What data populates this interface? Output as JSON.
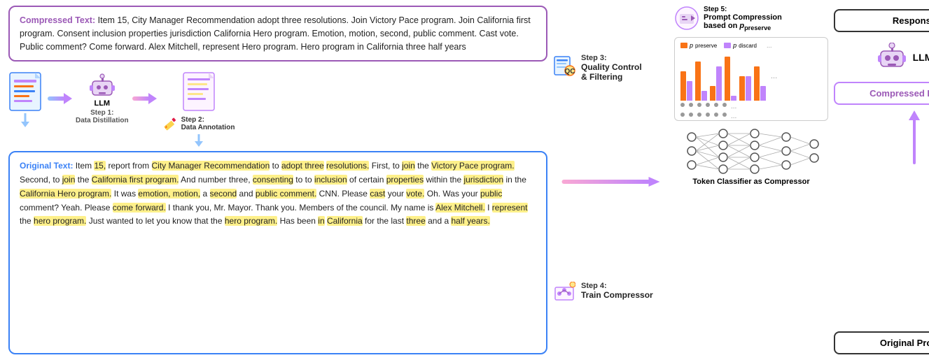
{
  "compressed_text": {
    "label": "Compressed Text:",
    "content": "Item 15, City Manager Recommendation adopt three resolutions. Join Victory Pace program. Join California first program. Consent inclusion properties jurisdiction California Hero program. Emotion, motion, second, public comment. Cast vote. Public comment? Come forward. Alex Mitchell, represent Hero program. Hero program in California three half years"
  },
  "original_text": {
    "label": "Original Text:",
    "sentences": [
      {
        "text": "Item ",
        "highlight": false
      },
      {
        "text": "15,",
        "highlight": true
      },
      {
        "text": " report from ",
        "highlight": false
      },
      {
        "text": "City Manager Recommendation",
        "highlight": true
      },
      {
        "text": " to ",
        "highlight": false
      },
      {
        "text": "adopt three",
        "highlight": true
      },
      {
        "text": "\n",
        "highlight": false
      },
      {
        "text": "resolutions.",
        "highlight": true
      },
      {
        "text": " First, to ",
        "highlight": false
      },
      {
        "text": "join",
        "highlight": true
      },
      {
        "text": " the ",
        "highlight": false
      },
      {
        "text": "Victory Pace program.",
        "highlight": true
      },
      {
        "text": " Second, to ",
        "highlight": false
      },
      {
        "text": "join",
        "highlight": true
      },
      {
        "text": " the\n",
        "highlight": false
      },
      {
        "text": "California first program.",
        "highlight": true
      },
      {
        "text": " And number three, ",
        "highlight": false
      },
      {
        "text": "consenting",
        "highlight": true
      },
      {
        "text": " to to ",
        "highlight": false
      },
      {
        "text": "inclusion",
        "highlight": true
      },
      {
        "text": " of\ncertain ",
        "highlight": false
      },
      {
        "text": "properties",
        "highlight": true
      },
      {
        "text": " within the ",
        "highlight": false
      },
      {
        "text": "jurisdiction",
        "highlight": true
      },
      {
        "text": " in the ",
        "highlight": false
      },
      {
        "text": "California Hero program.",
        "highlight": true
      },
      {
        "text": " It\nwas ",
        "highlight": false
      },
      {
        "text": "emotion, motion,",
        "highlight": true
      },
      {
        "text": " a ",
        "highlight": false
      },
      {
        "text": "second",
        "highlight": true
      },
      {
        "text": " and ",
        "highlight": false
      },
      {
        "text": "public comment.",
        "highlight": true
      },
      {
        "text": " CNN. Please ",
        "highlight": false
      },
      {
        "text": "cast",
        "highlight": true
      },
      {
        "text": " your ",
        "highlight": false
      },
      {
        "text": "vote.",
        "highlight": true
      },
      {
        "text": "\nOh. Was your ",
        "highlight": false
      },
      {
        "text": "public",
        "highlight": true
      },
      {
        "text": " comment? Yeah. Please ",
        "highlight": false
      },
      {
        "text": "come forward.",
        "highlight": true
      },
      {
        "text": " I thank you, Mr. Mayor.\nThank you. Members of the council. My name is ",
        "highlight": false
      },
      {
        "text": "Alex Mitchell.",
        "highlight": true
      },
      {
        "text": " I ",
        "highlight": false
      },
      {
        "text": "represent",
        "highlight": true
      },
      {
        "text": " the\n",
        "highlight": false
      },
      {
        "text": "hero program.",
        "highlight": true
      },
      {
        "text": " Just wanted to let you know that the ",
        "highlight": false
      },
      {
        "text": "hero program.",
        "highlight": true
      },
      {
        "text": " Has been ",
        "highlight": false
      },
      {
        "text": "in",
        "highlight": true
      },
      {
        "text": "\n",
        "highlight": false
      },
      {
        "text": "California",
        "highlight": true
      },
      {
        "text": " for the last ",
        "highlight": false
      },
      {
        "text": "three",
        "highlight": true
      },
      {
        "text": " and a ",
        "highlight": false
      },
      {
        "text": "half years.",
        "highlight": true
      }
    ]
  },
  "steps": {
    "step1": {
      "num": "Step 1:",
      "title": "Data Distillation"
    },
    "step2": {
      "num": "Step 2:",
      "title": "Data Annotation"
    },
    "step3": {
      "num": "Step 3:",
      "title": "Quality Control\n& Filtering"
    },
    "step4": {
      "num": "Step 4:",
      "title": "Train Compressor"
    },
    "step5": {
      "num": "Step 5:",
      "title": "Prompt Compression\nbased on p_preserve"
    }
  },
  "right_panel": {
    "response_label": "Response",
    "llm_label": "LLM",
    "compressed_prompt_label": "Compressed Prompt",
    "original_prompt_label": "Original Prompt",
    "classifier_title": "Token Classifier as Compressor"
  },
  "chart": {
    "legend": [
      {
        "label": "p_preserve",
        "color": "#f97316"
      },
      {
        "label": "p_discard",
        "color": "#c084fc"
      }
    ],
    "bars": [
      {
        "preserve": 60,
        "discard": 40
      },
      {
        "preserve": 80,
        "discard": 20
      },
      {
        "preserve": 30,
        "discard": 70
      },
      {
        "preserve": 90,
        "discard": 10
      },
      {
        "preserve": 50,
        "discard": 50
      },
      {
        "preserve": 70,
        "discard": 30
      }
    ]
  }
}
